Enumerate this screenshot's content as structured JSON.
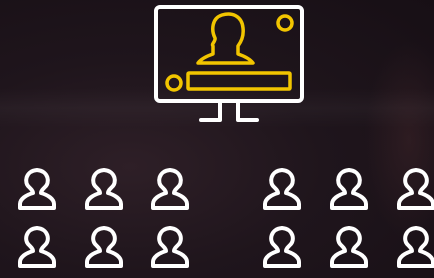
{
  "scene": {
    "background_color": "#1f151c",
    "icons": {
      "monitor": "monitor-with-presenter-icon",
      "audience_member": "person-outline-icon"
    },
    "colors": {
      "outline": "#ffffff",
      "accent": "#f2c500"
    },
    "audience": {
      "rows": 2,
      "per_row": 6
    }
  }
}
